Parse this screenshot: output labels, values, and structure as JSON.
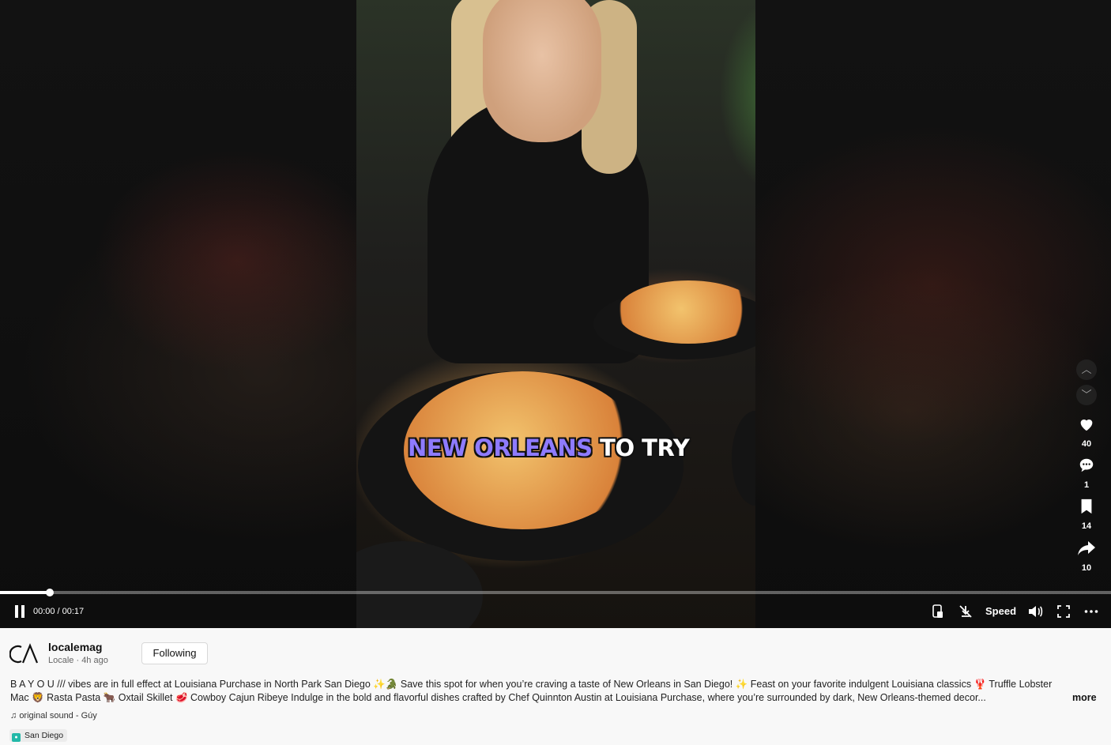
{
  "video": {
    "caption_highlight": "NEW ORLEANS",
    "caption_rest": "TO TRY",
    "progress_fraction": 0.045,
    "time_current": "00:00",
    "time_separator": "/",
    "time_total": "00:17",
    "speed_label": "Speed"
  },
  "side_actions": {
    "likes": "40",
    "comments": "1",
    "saves": "14",
    "shares": "10"
  },
  "post": {
    "username": "localemag",
    "meta": "Locale · 4h ago",
    "follow_label": "Following",
    "description": "B A Y O U /// vibes are in full effect at Louisiana Purchase in North Park San Diego ✨🐊 Save this spot for when you’re craving a taste of New Orleans in San Diego! ✨ Feast on your favorite indulgent Louisiana classics 🦞 Truffle Lobster Mac 🦁 Rasta Pasta 🐂 Oxtail Skillet 🥩 Cowboy Cajun Ribeye Indulge in the bold and flavorful dishes crafted by Chef Quinnton Austin at Louisiana Purchase, where you’re surrounded by dark, New Orleans-themed decor...",
    "more_label": "more",
    "sound": "original sound - Gúy",
    "location": "San Diego"
  },
  "colors": {
    "caption_highlight": "#8e7bff",
    "location_badge": "#22b8a8"
  }
}
